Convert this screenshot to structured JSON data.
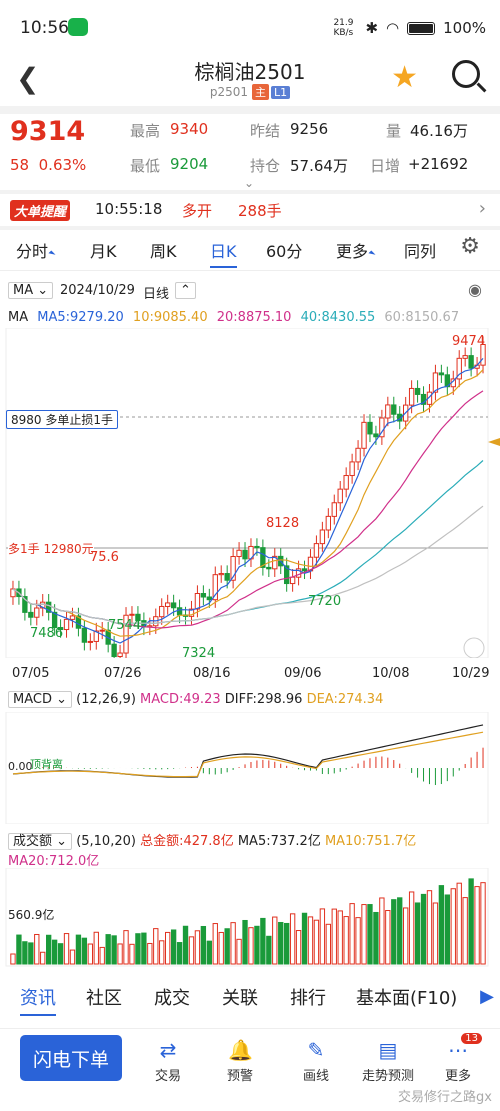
{
  "status": {
    "time": "10:56",
    "net_speed": "21.9 KB/s",
    "battery": "100%"
  },
  "header": {
    "title": "棕榈油2501",
    "subtitle": "p2501",
    "tag_main": "主",
    "tag_l1": "L1"
  },
  "quote": {
    "price": "9314",
    "change": "58",
    "change_pct": "0.63%",
    "high_label": "最高",
    "high": "9340",
    "low_label": "最低",
    "low": "9204",
    "prev_close_label": "昨结",
    "prev_close": "9256",
    "hold_label": "持仓",
    "hold": "57.64万",
    "vol_label": "量",
    "vol": "46.16万",
    "day_inc_label": "日增",
    "day_inc": "+21692"
  },
  "alert": {
    "tag": "大单提醒",
    "time": "10:55:18",
    "action": "多开",
    "qty": "288手"
  },
  "tabs": [
    "分时",
    "月K",
    "周K",
    "日K",
    "60分",
    "更多",
    "同列"
  ],
  "chart_bar": {
    "ma_select": "MA",
    "date": "2024/10/29",
    "period": "日线"
  },
  "ma": {
    "label": "MA",
    "ma5": "MA5:9279.20",
    "ma10": "10:9085.40",
    "ma20": "20:8875.10",
    "ma40": "40:8430.55",
    "ma60": "60:8150.67"
  },
  "colors": {
    "up": "#e0301e",
    "down": "#1a9a3a",
    "ma5": "#2a63d8",
    "ma10": "#e0a020",
    "ma20": "#d0308a",
    "ma40": "#2aacb8",
    "ma60": "#b0b0b0",
    "accent": "#2a63d8"
  },
  "kline": {
    "stop_line": "8980 多单止损1手",
    "stop_left": "8980",
    "position_line": "多1手 12980元",
    "labels": {
      "p9474": "9474",
      "p8128": "8128",
      "p7720": "7720",
      "p7486": "7486",
      "p7544": "7544",
      "p7324": "7324",
      "p7576": "75.6"
    },
    "dates": [
      "07/05",
      "07/26",
      "08/16",
      "09/06",
      "10/08",
      "10/29"
    ]
  },
  "macd": {
    "select": "MACD",
    "params": "(12,26,9)",
    "macd": "MACD:49.23",
    "diff": "DIFF:298.96",
    "dea": "DEA:274.34",
    "zero": "0.00",
    "note": "顶背离"
  },
  "volume": {
    "select": "成交额",
    "params": "(5,10,20)",
    "total": "总金额:427.8亿",
    "ma5": "MA5:737.2亿",
    "ma10": "MA10:751.7亿",
    "ma20": "MA20:712.0亿",
    "axis": "560.9亿"
  },
  "footer_tabs": [
    "资讯",
    "社区",
    "成交",
    "关联",
    "排行",
    "基本面(F10)"
  ],
  "bottom": {
    "flash": "闪电下单",
    "trade": "交易",
    "alert": "预警",
    "draw": "画线",
    "trend": "走势预测",
    "more": "更多",
    "badge": "13"
  },
  "watermark": "交易修行之路gx"
}
